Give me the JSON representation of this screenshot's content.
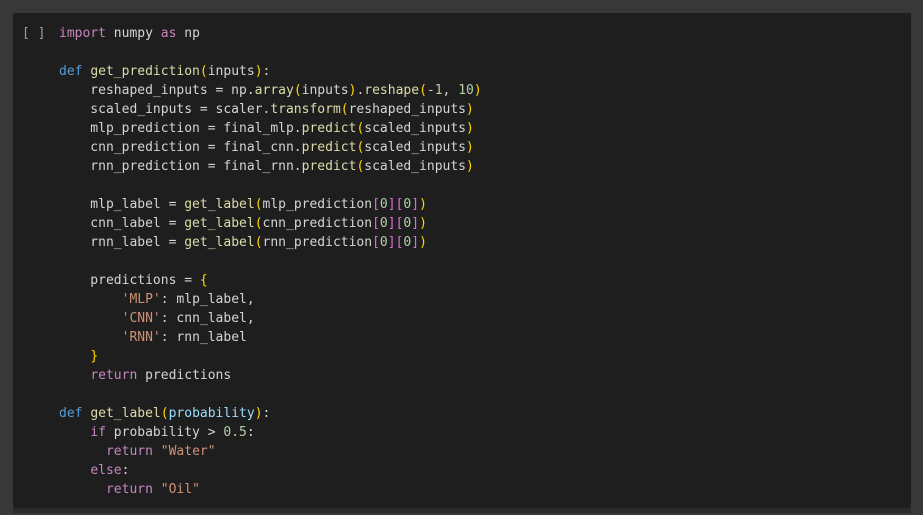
{
  "cell": {
    "run_indicator": "[ ]",
    "lines": [
      [
        {
          "t": "import",
          "c": "kw"
        },
        {
          "t": " numpy ",
          "c": ""
        },
        {
          "t": "as",
          "c": "kw"
        },
        {
          "t": " np",
          "c": ""
        }
      ],
      [],
      [
        {
          "t": "def",
          "c": "def"
        },
        {
          "t": " ",
          "c": ""
        },
        {
          "t": "get_prediction",
          "c": "fn"
        },
        {
          "t": "(",
          "c": "br1"
        },
        {
          "t": "inputs",
          "c": ""
        },
        {
          "t": ")",
          "c": "br1"
        },
        {
          "t": ":",
          "c": ""
        }
      ],
      [
        {
          "t": "    reshaped_inputs = np.",
          "c": ""
        },
        {
          "t": "array",
          "c": "fn"
        },
        {
          "t": "(",
          "c": "br1"
        },
        {
          "t": "inputs",
          "c": ""
        },
        {
          "t": ")",
          "c": "br1"
        },
        {
          "t": ".",
          "c": ""
        },
        {
          "t": "reshape",
          "c": "fn"
        },
        {
          "t": "(",
          "c": "br1"
        },
        {
          "t": "-",
          "c": ""
        },
        {
          "t": "1",
          "c": "num"
        },
        {
          "t": ", ",
          "c": ""
        },
        {
          "t": "10",
          "c": "num"
        },
        {
          "t": ")",
          "c": "br1"
        }
      ],
      [
        {
          "t": "    scaled_inputs = scaler.",
          "c": ""
        },
        {
          "t": "transform",
          "c": "fn"
        },
        {
          "t": "(",
          "c": "br1"
        },
        {
          "t": "reshaped_inputs",
          "c": ""
        },
        {
          "t": ")",
          "c": "br1"
        }
      ],
      [
        {
          "t": "    mlp_prediction = final_mlp.",
          "c": ""
        },
        {
          "t": "predict",
          "c": "fn"
        },
        {
          "t": "(",
          "c": "br1"
        },
        {
          "t": "scaled_inputs",
          "c": ""
        },
        {
          "t": ")",
          "c": "br1"
        }
      ],
      [
        {
          "t": "    cnn_prediction = final_cnn.",
          "c": ""
        },
        {
          "t": "predict",
          "c": "fn"
        },
        {
          "t": "(",
          "c": "br1"
        },
        {
          "t": "scaled_inputs",
          "c": ""
        },
        {
          "t": ")",
          "c": "br1"
        }
      ],
      [
        {
          "t": "    rnn_prediction = final_rnn.",
          "c": ""
        },
        {
          "t": "predict",
          "c": "fn"
        },
        {
          "t": "(",
          "c": "br1"
        },
        {
          "t": "scaled_inputs",
          "c": ""
        },
        {
          "t": ")",
          "c": "br1"
        }
      ],
      [],
      [
        {
          "t": "    mlp_label = ",
          "c": ""
        },
        {
          "t": "get_label",
          "c": "fn"
        },
        {
          "t": "(",
          "c": "br1"
        },
        {
          "t": "mlp_prediction",
          "c": ""
        },
        {
          "t": "[",
          "c": "br2"
        },
        {
          "t": "0",
          "c": "num"
        },
        {
          "t": "]",
          "c": "br2"
        },
        {
          "t": "[",
          "c": "br2"
        },
        {
          "t": "0",
          "c": "num"
        },
        {
          "t": "]",
          "c": "br2"
        },
        {
          "t": ")",
          "c": "br1"
        }
      ],
      [
        {
          "t": "    cnn_label = ",
          "c": ""
        },
        {
          "t": "get_label",
          "c": "fn"
        },
        {
          "t": "(",
          "c": "br1"
        },
        {
          "t": "cnn_prediction",
          "c": ""
        },
        {
          "t": "[",
          "c": "br2"
        },
        {
          "t": "0",
          "c": "num"
        },
        {
          "t": "]",
          "c": "br2"
        },
        {
          "t": "[",
          "c": "br2"
        },
        {
          "t": "0",
          "c": "num"
        },
        {
          "t": "]",
          "c": "br2"
        },
        {
          "t": ")",
          "c": "br1"
        }
      ],
      [
        {
          "t": "    rnn_label = ",
          "c": ""
        },
        {
          "t": "get_label",
          "c": "fn"
        },
        {
          "t": "(",
          "c": "br1"
        },
        {
          "t": "rnn_prediction",
          "c": ""
        },
        {
          "t": "[",
          "c": "br2"
        },
        {
          "t": "0",
          "c": "num"
        },
        {
          "t": "]",
          "c": "br2"
        },
        {
          "t": "[",
          "c": "br2"
        },
        {
          "t": "0",
          "c": "num"
        },
        {
          "t": "]",
          "c": "br2"
        },
        {
          "t": ")",
          "c": "br1"
        }
      ],
      [],
      [
        {
          "t": "    predictions = ",
          "c": ""
        },
        {
          "t": "{",
          "c": "br1"
        }
      ],
      [
        {
          "t": "        ",
          "c": ""
        },
        {
          "t": "'MLP'",
          "c": "str"
        },
        {
          "t": ": mlp_label,",
          "c": ""
        }
      ],
      [
        {
          "t": "        ",
          "c": ""
        },
        {
          "t": "'CNN'",
          "c": "str"
        },
        {
          "t": ": cnn_label,",
          "c": ""
        }
      ],
      [
        {
          "t": "        ",
          "c": ""
        },
        {
          "t": "'RNN'",
          "c": "str"
        },
        {
          "t": ": rnn_label",
          "c": ""
        }
      ],
      [
        {
          "t": "    ",
          "c": ""
        },
        {
          "t": "}",
          "c": "br1"
        }
      ],
      [
        {
          "t": "    ",
          "c": ""
        },
        {
          "t": "return",
          "c": "kw"
        },
        {
          "t": " predictions",
          "c": ""
        }
      ],
      [],
      [
        {
          "t": "def",
          "c": "def"
        },
        {
          "t": " ",
          "c": ""
        },
        {
          "t": "get_label",
          "c": "fn"
        },
        {
          "t": "(",
          "c": "br1"
        },
        {
          "t": "probability",
          "c": "param"
        },
        {
          "t": ")",
          "c": "br1"
        },
        {
          "t": ":",
          "c": ""
        }
      ],
      [
        {
          "t": "    ",
          "c": ""
        },
        {
          "t": "if",
          "c": "kw"
        },
        {
          "t": " probability > ",
          "c": ""
        },
        {
          "t": "0.5",
          "c": "num"
        },
        {
          "t": ":",
          "c": ""
        }
      ],
      [
        {
          "t": "      ",
          "c": ""
        },
        {
          "t": "return",
          "c": "kw"
        },
        {
          "t": " ",
          "c": ""
        },
        {
          "t": "\"Water\"",
          "c": "str"
        }
      ],
      [
        {
          "t": "    ",
          "c": ""
        },
        {
          "t": "else",
          "c": "kw"
        },
        {
          "t": ":",
          "c": ""
        }
      ],
      [
        {
          "t": "      ",
          "c": ""
        },
        {
          "t": "return",
          "c": "kw"
        },
        {
          "t": " ",
          "c": ""
        },
        {
          "t": "\"Oil\"",
          "c": "str"
        }
      ]
    ]
  },
  "colors": {
    "background": "#383838",
    "cell_background": "#1e1e1e",
    "keyword": "#c586c0",
    "def_keyword": "#569cd6",
    "function": "#dcdcaa",
    "string": "#ce9178",
    "number": "#b5cea8",
    "bracket": "#ffd700",
    "index_bracket": "#da70d6"
  }
}
